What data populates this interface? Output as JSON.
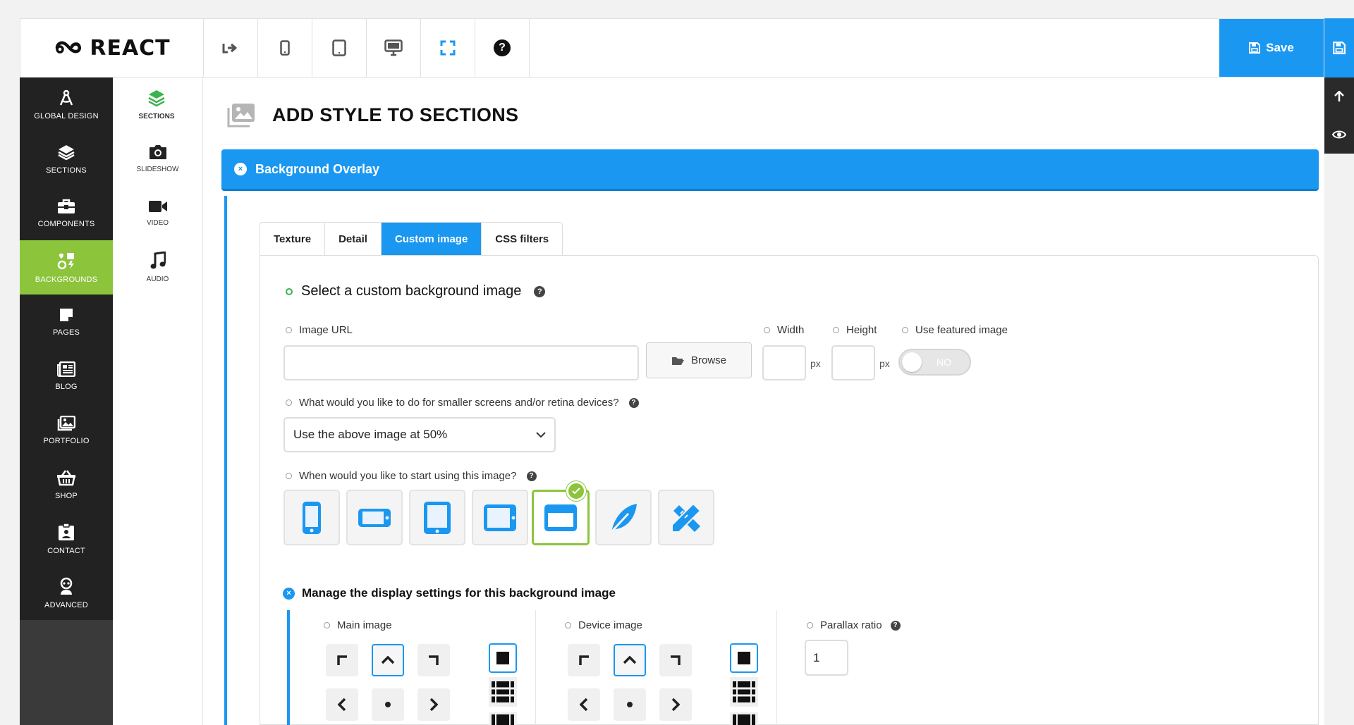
{
  "brand": {
    "name": "REACT"
  },
  "toolbar": {
    "tools": [
      {
        "icon": "exit-icon"
      },
      {
        "icon": "phone-icon"
      },
      {
        "icon": "tablet-icon"
      },
      {
        "icon": "desktop-icon"
      },
      {
        "icon": "fullscreen-icon"
      },
      {
        "icon": "help-icon",
        "glyph": "?"
      }
    ],
    "save_label": "Save"
  },
  "rail": {
    "items": [
      "save-icon",
      "arrow-up-icon",
      "eye-icon"
    ]
  },
  "sidebar": {
    "items": [
      {
        "label": "GLOBAL DESIGN",
        "icon": "compass-icon"
      },
      {
        "label": "SECTIONS",
        "icon": "layers-icon"
      },
      {
        "label": "COMPONENTS",
        "icon": "toolbox-icon"
      },
      {
        "label": "BACKGROUNDS",
        "icon": "shapes-icon",
        "active": true
      },
      {
        "label": "PAGES",
        "icon": "page-icon"
      },
      {
        "label": "BLOG",
        "icon": "newspaper-icon"
      },
      {
        "label": "PORTFOLIO",
        "icon": "images-icon"
      },
      {
        "label": "SHOP",
        "icon": "basket-icon"
      },
      {
        "label": "CONTACT",
        "icon": "id-card-icon"
      },
      {
        "label": "ADVANCED",
        "icon": "robot-icon"
      }
    ]
  },
  "submenu": {
    "items": [
      {
        "label": "SECTIONS",
        "icon": "layers-icon",
        "active": true
      },
      {
        "label": "SLIDESHOW",
        "icon": "camera-icon"
      },
      {
        "label": "VIDEO",
        "icon": "video-icon"
      },
      {
        "label": "AUDIO",
        "icon": "music-icon"
      }
    ]
  },
  "main": {
    "title": "ADD STYLE TO SECTIONS",
    "overlay_title": "Background Overlay",
    "overlay_close": "×",
    "tabs": [
      {
        "label": "Texture"
      },
      {
        "label": "Detail"
      },
      {
        "label": "Custom image",
        "active": true
      },
      {
        "label": "CSS filters"
      }
    ],
    "custom": {
      "heading": "Select a custom background image",
      "help": "?",
      "image_url_label": "Image URL",
      "image_url_value": "",
      "browse_label": "Browse",
      "width_label": "Width",
      "width_value": "",
      "height_label": "Height",
      "height_value": "",
      "px": "px",
      "featured_label": "Use featured image",
      "featured_value": "NO",
      "retina_label": "What would you like to do for smaller screens and/or retina devices?",
      "retina_value": "Use the above image at 50%",
      "start_label": "When would you like to start using this image?",
      "breakpoints": [
        {
          "icon": "phone-portrait-icon"
        },
        {
          "icon": "phone-landscape-icon"
        },
        {
          "icon": "tablet-portrait-icon"
        },
        {
          "icon": "tablet-landscape-icon"
        },
        {
          "icon": "desktop-window-icon",
          "selected": true
        },
        {
          "icon": "feather-icon"
        },
        {
          "icon": "pencil-ruler-icon"
        }
      ],
      "display_heading": "Manage the display settings for this background image",
      "display_close": "×",
      "main_image_label": "Main image",
      "device_image_label": "Device image",
      "parallax_label": "Parallax ratio",
      "parallax_value": "1"
    }
  },
  "colors": {
    "accent": "#1a97f0",
    "active_green": "#8cc43c",
    "sidebar": "#222222"
  }
}
